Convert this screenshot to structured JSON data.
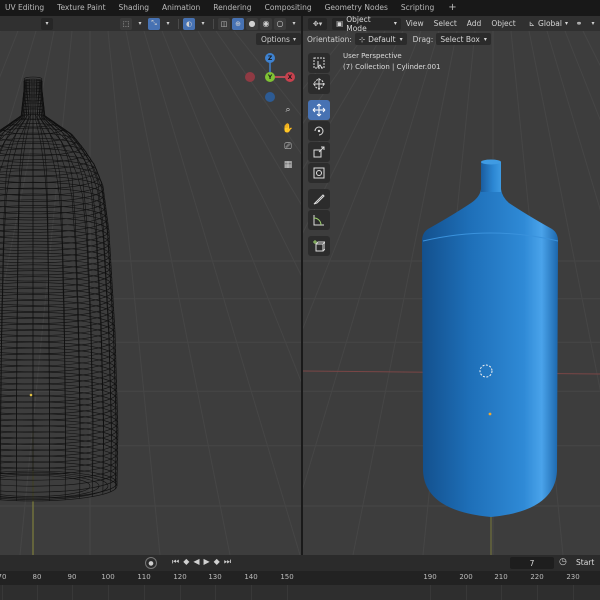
{
  "workspace_tabs": [
    "UV Editing",
    "Texture Paint",
    "Shading",
    "Animation",
    "Rendering",
    "Compositing",
    "Geometry Nodes",
    "Scripting"
  ],
  "workspace_add": "+",
  "right_header": {
    "mode": "Object Mode",
    "menus": [
      "View",
      "Select",
      "Add",
      "Object"
    ],
    "transform_orientation": "Global"
  },
  "tool_settings": {
    "orientation_label": "Orientation:",
    "orientation_value": "Default",
    "drag_label": "Drag:",
    "drag_value": "Select Box"
  },
  "left_viewport": {
    "options_label": "Options",
    "gizmo": {
      "z": "Z",
      "y": "Y",
      "x": "X"
    }
  },
  "right_viewport": {
    "perspective_label": "User Perspective",
    "collection_label": "(7) Collection | Cylinder.001"
  },
  "timeline": {
    "current_frame": "7",
    "start_label": "Start",
    "ticks": [
      "70",
      "80",
      "90",
      "100",
      "110",
      "120",
      "130",
      "140",
      "150",
      "190",
      "200",
      "210",
      "220",
      "230"
    ]
  },
  "colors": {
    "accent": "#4772b3",
    "gizmo_x": "#e0505e",
    "gizmo_y": "#7fc334",
    "gizmo_z": "#3e82d0",
    "object_blue": "#1e6fb8"
  }
}
